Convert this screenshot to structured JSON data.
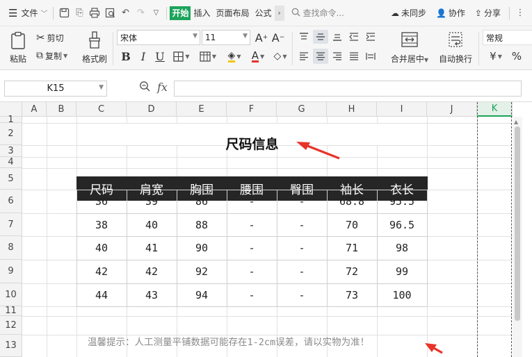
{
  "menubar": {
    "file_label": "文件",
    "tabs": [
      "开始",
      "插入",
      "页面布局",
      "公式"
    ],
    "search_placeholder": "查找命令...",
    "sync_label": "未同步",
    "collab_label": "协作",
    "share_label": "分享"
  },
  "ribbon": {
    "paste": "粘贴",
    "cut": "剪切",
    "copy": "复制",
    "format_painter": "格式刷",
    "font_name": "宋体",
    "font_size": "11",
    "merge_center": "合并居中",
    "wrap_text": "自动换行",
    "number_format": "常规",
    "currency_symbol": "¥",
    "percent_symbol": "%",
    "bold": "B",
    "italic": "I",
    "underline": "U"
  },
  "formula_bar": {
    "cell_ref": "K15",
    "fx_label": "fx",
    "formula": ""
  },
  "sheet": {
    "columns": [
      "A",
      "B",
      "C",
      "D",
      "E",
      "F",
      "G",
      "H",
      "I",
      "J",
      "K"
    ],
    "selected_column": "K",
    "rows": [
      "1",
      "2",
      "3",
      "4",
      "5",
      "6",
      "7",
      "8",
      "9",
      "10",
      "11",
      "12",
      "13"
    ],
    "title": "尺码信息",
    "headers": [
      "尺码",
      "肩宽",
      "胸围",
      "腰围",
      "臀围",
      "袖长",
      "衣长"
    ],
    "data": [
      [
        "36",
        "39",
        "86",
        "-",
        "-",
        "68.8",
        "95.5"
      ],
      [
        "38",
        "40",
        "88",
        "-",
        "-",
        "70",
        "96.5"
      ],
      [
        "40",
        "41",
        "90",
        "-",
        "-",
        "71",
        "98"
      ],
      [
        "42",
        "42",
        "92",
        "-",
        "-",
        "72",
        "99"
      ],
      [
        "44",
        "43",
        "94",
        "-",
        "-",
        "73",
        "100"
      ]
    ],
    "note": "温馨提示：人工测量平铺数据可能存在1-2cm误差，请以实物为准！",
    "arrow_color": "#e8332a",
    "header_bg": "#262626"
  }
}
